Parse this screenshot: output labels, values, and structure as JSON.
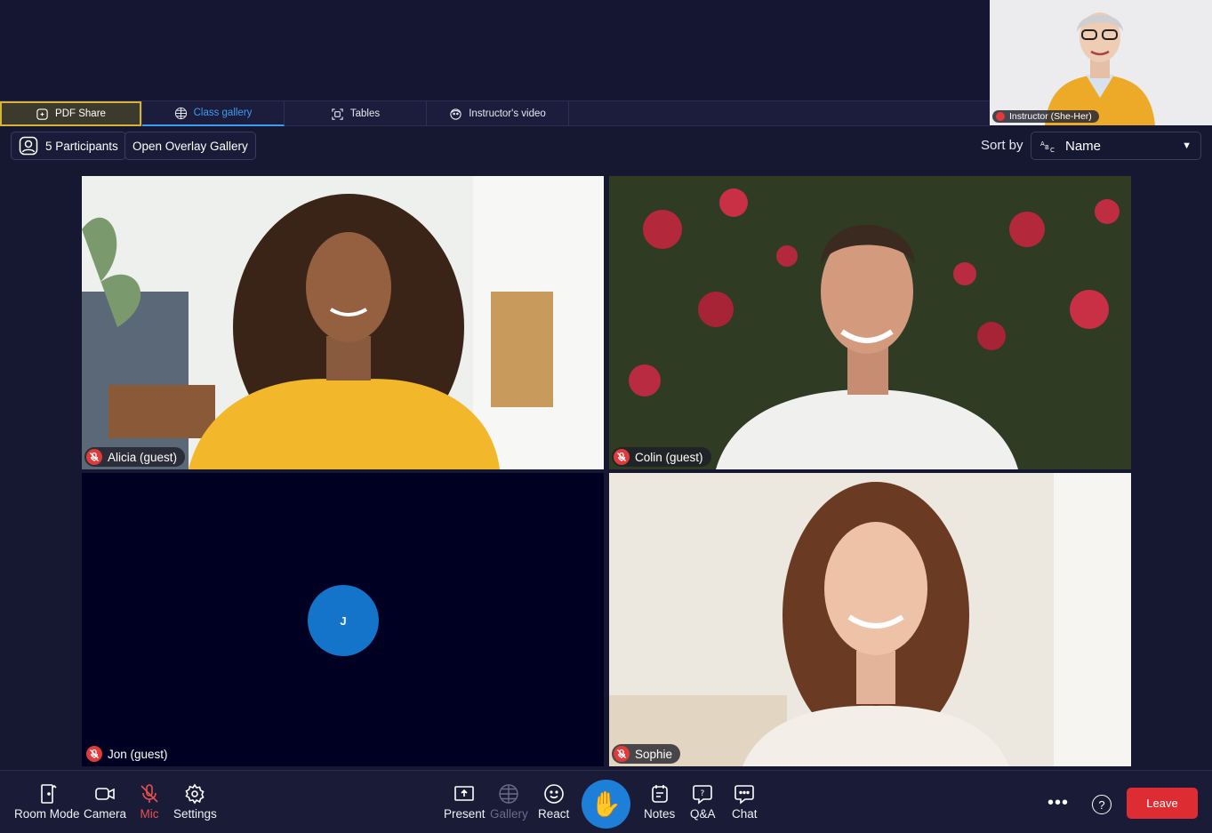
{
  "tabs": [
    {
      "label": "PDF Share",
      "icon": "pdf-share-icon",
      "highlight": true
    },
    {
      "label": "Class gallery",
      "icon": "grid-icon",
      "active": true
    },
    {
      "label": "Tables",
      "icon": "tables-icon"
    },
    {
      "label": "Instructor's video",
      "icon": "face-icon"
    }
  ],
  "instructor": {
    "label": "Instructor (She-Her)"
  },
  "toolbar": {
    "participants_label": "5 Participants",
    "overlay_label": "Open Overlay Gallery",
    "sort_label": "Sort by",
    "sort_value": "Name",
    "sort_icon": "abc-sort-icon"
  },
  "tiles": [
    {
      "name": "Alicia (guest)",
      "type": "video"
    },
    {
      "name": "Colin (guest)",
      "type": "video"
    },
    {
      "name": "Jon (guest)",
      "type": "avatar",
      "initial": "J"
    },
    {
      "name": "Sophie",
      "type": "video"
    }
  ],
  "bottombar": {
    "room_mode": "Room Mode",
    "camera": "Camera",
    "mic": "Mic",
    "settings": "Settings",
    "present": "Present",
    "gallery": "Gallery",
    "react": "React",
    "notes": "Notes",
    "qa": "Q&A",
    "chat": "Chat",
    "more": "•••",
    "help": "?",
    "leave": "Leave"
  },
  "colors": {
    "background": "#161731",
    "accent": "#3c9cf0",
    "leave": "#de2c33",
    "muted": "#e03a3a",
    "hand_button": "#1d7fd8"
  }
}
